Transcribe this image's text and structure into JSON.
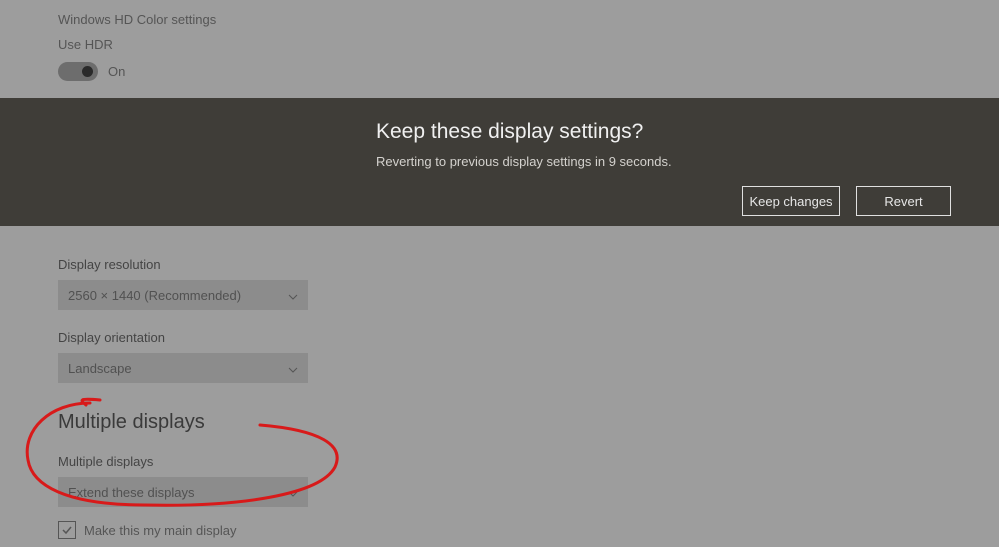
{
  "hdr": {
    "section_link": "Windows HD Color settings",
    "use_hdr_label": "Use HDR",
    "toggle_state": "On"
  },
  "resolution": {
    "label": "Display resolution",
    "value": "2560 × 1440 (Recommended)"
  },
  "orientation": {
    "label": "Display orientation",
    "value": "Landscape"
  },
  "multiple_displays": {
    "section_title": "Multiple displays",
    "label": "Multiple displays",
    "value": "Extend these displays",
    "checkbox_label": "Make this my main display"
  },
  "dialog": {
    "title": "Keep these display settings?",
    "subtitle_prefix": "Reverting to previous display settings in ",
    "seconds": "9",
    "subtitle_suffix": " seconds.",
    "keep_label": "Keep changes",
    "revert_label": "Revert"
  }
}
